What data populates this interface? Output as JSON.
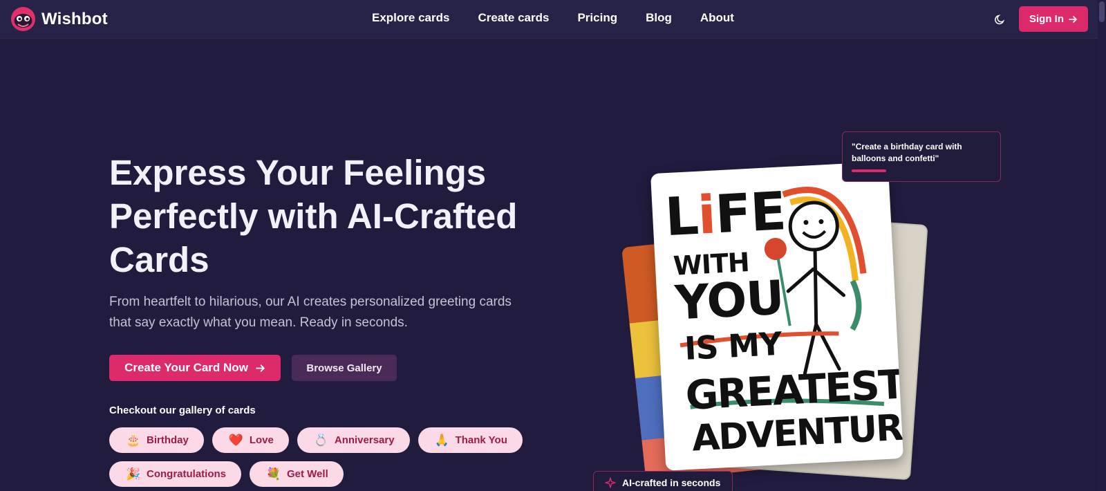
{
  "brand": {
    "name": "Wishbot",
    "logo_icon": "wishbot-mascot-icon",
    "accent": "#dc2a6b"
  },
  "nav": {
    "links": [
      "Explore cards",
      "Create cards",
      "Pricing",
      "Blog",
      "About"
    ],
    "theme_toggle_icon": "moon-icon",
    "signin_label": "Sign In"
  },
  "hero": {
    "title": "Express Your Feelings Perfectly with AI-Crafted Cards",
    "subtitle": "From heartfelt to hilarious, our AI creates personalized greeting cards that say exactly what you mean. Ready in seconds.",
    "primary_cta": "Create Your Card Now",
    "secondary_cta": "Browse Gallery",
    "gallery_label": "Checkout our gallery of cards",
    "categories": [
      {
        "emoji": "🎂",
        "label": "Birthday"
      },
      {
        "emoji": "❤️",
        "label": "Love"
      },
      {
        "emoji": "💍",
        "label": "Anniversary"
      },
      {
        "emoji": "🙏",
        "label": "Thank You"
      },
      {
        "emoji": "🎉",
        "label": "Congratulations"
      },
      {
        "emoji": "💐",
        "label": "Get Well"
      }
    ]
  },
  "showcase": {
    "prompt": "\"Create a birthday card with balloons and confetti\"",
    "badge": "AI-crafted in seconds",
    "card_lines": {
      "line1_pre": "L",
      "line1_i": "i",
      "line1_post": "FE",
      "line2": "WITH",
      "line3": "YOU",
      "line4": "IS MY",
      "line5": "GREATEST",
      "line6": "ADVENTURE."
    }
  }
}
